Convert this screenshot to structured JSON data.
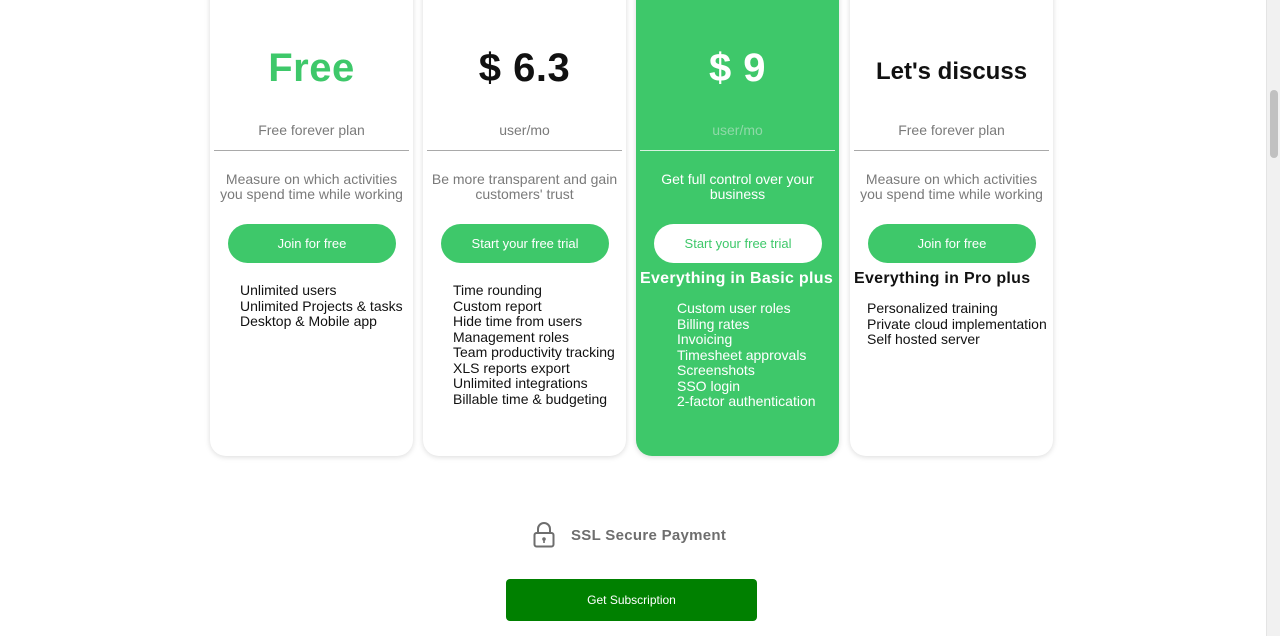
{
  "plans": [
    {
      "price": "Free",
      "subtitle": "Free forever plan",
      "description": "Measure on which activities you spend time while working",
      "button": "Join for free",
      "features_heading": "",
      "features": [
        "Unlimited users",
        "Unlimited Projects & tasks",
        "Desktop & Mobile app"
      ]
    },
    {
      "price": "$ 6.3",
      "subtitle": "user/mo",
      "description": "Be more transparent and gain customers' trust",
      "button": "Start your free trial",
      "features_heading": "",
      "features": [
        "Time rounding",
        "Custom report",
        "Hide time from users",
        "Management roles",
        "Team productivity tracking",
        "XLS reports export",
        "Unlimited integrations",
        "Billable time & budgeting"
      ]
    },
    {
      "price": "$ 9",
      "subtitle": "user/mo",
      "description": "Get full control over your business",
      "button": "Start your free trial",
      "features_heading": "Everything in Basic plus",
      "features": [
        "Custom user roles",
        "Billing rates",
        "Invoicing",
        "Timesheet approvals",
        "Screenshots",
        "SSO login",
        "2-factor authentication"
      ]
    },
    {
      "price": "Let's discuss",
      "subtitle": "Free forever plan",
      "description": "Measure on which activities you spend time while working",
      "button": "Join for free",
      "features_heading": "Everything in Pro plus",
      "features": [
        "Personalized training",
        "Private cloud implementation",
        "Self hosted server"
      ]
    }
  ],
  "ssl": {
    "icon": "lock-icon",
    "label": "SSL Secure Payment"
  },
  "subscribe": {
    "label": "Get Subscription"
  },
  "colors": {
    "accent": "#3ec86a",
    "subscribe": "#008000",
    "muted": "#7a7a7a"
  }
}
